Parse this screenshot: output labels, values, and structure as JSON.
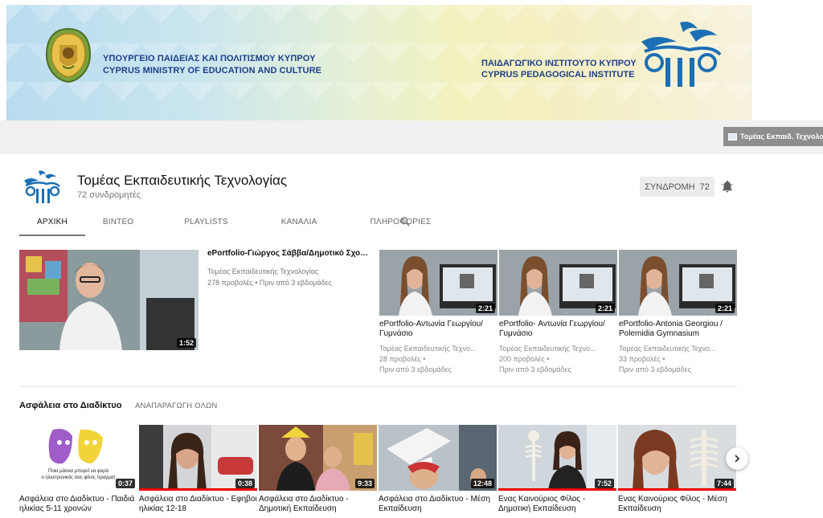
{
  "banner": {
    "ministry_line1": "ΥΠΟΥΡΓΕΙΟ ΠΑΙΔΕΙΑΣ ΚΑΙ ΠΟΛΙΤΙΣΜΟΥ ΚΥΠΡΟΥ",
    "ministry_line2": "CYPRUS MINISTRY OF EDUCATION AND CULTURE",
    "institute_line1": "ΠΑΙΔΑΓΩΓΙΚΟ ΙΝΣΤΙΤΟΥΤΟ ΚΥΠΡΟΥ",
    "institute_line2": "CYPRUS PEDAGOGICAL INSTITUTE",
    "link_label": "Τομέας Εκπαιδ. Τεχνολογίας"
  },
  "channel": {
    "title": "Τομέας Εκπαιδευτικής Τεχνολογίας",
    "subscribers": "72 συνδρομητές",
    "subscribe_label": "ΣΥΝΔΡΟΜΗ",
    "subscribe_count": "72"
  },
  "tabs": [
    "ΑΡΧΙΚΗ",
    "ΒΙΝΤΕΟ",
    "PLAYLISTS",
    "ΚΑΝΑΛΙΑ",
    "ΠΛΗΡΟΦΟΡΙΕΣ"
  ],
  "featured": {
    "title": "ePortfolio-Γιώργος Σάββα/Δημοτικό Σχολεί...",
    "channel": "Τομέας Εκπαιδευτικής Τεχνολογίας",
    "views_age": "278 προβολές • Πριν από 3 εβδομάδες",
    "duration": "1:52"
  },
  "top_videos": [
    {
      "title": "ePortfolio-Αντωνία Γεωργίου/ Γυμνάσιο",
      "channel": "Τομέας Εκπαιδευτικής Τεχνο...",
      "views": "28 προβολές •",
      "age": "Πριν από 3 εβδομάδες",
      "duration": "2:21"
    },
    {
      "title": "ePortfolio- Αντωνία Γεωργίου/ Γυμνάσιο",
      "channel": "Τομέας Εκπαιδευτικής Τεχνο...",
      "views": "200 προβολές •",
      "age": "Πριν από 3 εβδομάδες",
      "duration": "2:21"
    },
    {
      "title": "ePortfolio-Antonia Georgiou / Polemidia Gymnasium",
      "channel": "Τομέας Εκπαιδευτικής Τεχνο...",
      "views": "33 προβολές •",
      "age": "Πριν από 3 εβδομάδες",
      "duration": "2:21"
    }
  ],
  "section": {
    "title": "Ασφάλεια στο Διαδίκτυο",
    "play_all": "ΑΝΑΠΑΡΑΓΩΓΗ ΟΛΩΝ"
  },
  "shelf_videos": [
    {
      "title": "Ασφάλεια στο Διαδίκτυο - Παιδιά ηλικίας 5-11 χρονών",
      "duration": "0:37",
      "caption1": "Ποια μάσκα μπορεί να φορά",
      "caption2": "ο ηλεκτρονικός σας φίλος πραγματ"
    },
    {
      "title": "Ασφάλεια στο Διαδίκτυο - Εφηβοι ηλικίας 12-18",
      "duration": "0:38"
    },
    {
      "title": "Ασφάλεια στο Διαδίκτυο - Δημοτική Εκπαίδευση",
      "duration": "9:33"
    },
    {
      "title": "Ασφάλεια στο Διαδίκτυο - Μέση Εκπαίδευση",
      "duration": "12:48"
    },
    {
      "title": "Ενας Καινούριος Φίλος - Δημοτική Εκπαίδευση",
      "duration": "7:52"
    },
    {
      "title": "Ενας Καινούριος Φίλος - Μέση Εκπαίδευση",
      "duration": "7:44"
    }
  ],
  "colors": {
    "banner_blue": "#1e3f8a",
    "logo_blue": "#1c6fb4",
    "progress_red": "#e00000"
  }
}
